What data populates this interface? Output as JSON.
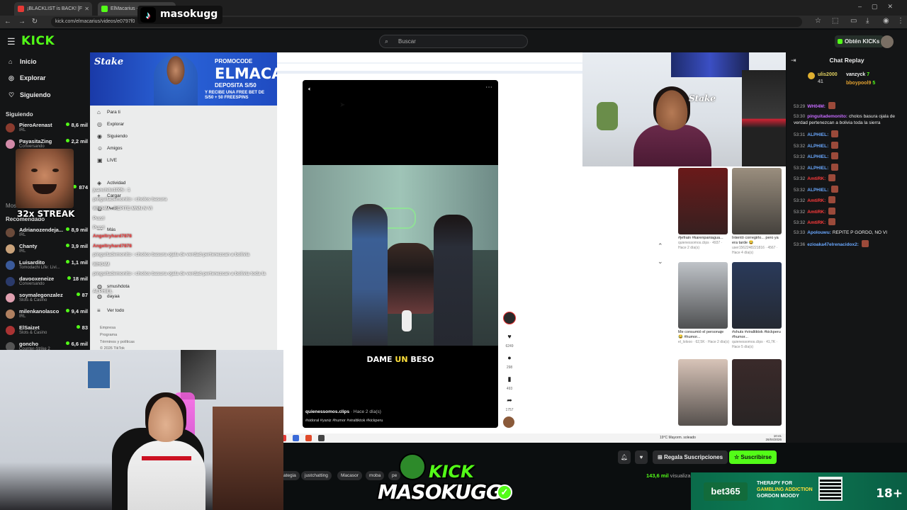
{
  "browser": {
    "tabs": [
      {
        "label": "¡BLACKLIST is BACK! [F",
        "fav_color": "#e53935"
      },
      {
        "label": "ElMacarius - W",
        "fav_color": "#53fc18"
      }
    ],
    "url": "kick.com/elmacarius/videos/e0797f0"
  },
  "overlay": {
    "tiktok_handle": "masokugg",
    "streak_text": "32x STREAK",
    "kick_logo_top": "KICK",
    "kick_logo_bottom": "MASOKUGG"
  },
  "kick": {
    "logo": "KICK",
    "search_placeholder": "Buscar",
    "get_kicks": "Obtén KICKs",
    "nav": [
      {
        "icon": "home-icon",
        "glyph": "⌂",
        "label": "Inicio"
      },
      {
        "icon": "compass-icon",
        "glyph": "◎",
        "label": "Explorar"
      },
      {
        "icon": "heart-icon",
        "glyph": "♡",
        "label": "Siguiendo"
      }
    ],
    "following_heading": "Siguiendo",
    "following": [
      {
        "name": "PieroArenast",
        "category": "IRL",
        "viewers": "8,6 mil",
        "color": "#8a3b2e"
      },
      {
        "name": "PayasitaZing",
        "category": "Conversando",
        "viewers": "2,2 mil",
        "color": "#d28aa8"
      }
    ],
    "partial_viewers": "874",
    "more_label": "Mos",
    "recommended_heading": "Recomendado",
    "recommended": [
      {
        "name": "Adrianozendeja...",
        "category": "IRL",
        "viewers": "8,9 mil",
        "color": "#6a4a3a"
      },
      {
        "name": "Chanty",
        "category": "IRL",
        "viewers": "3,9 mil",
        "color": "#c9a27a"
      },
      {
        "name": "Luisardito",
        "category": "Tomodachi Life: Livi...",
        "viewers": "1,1 mil",
        "color": "#3a5a9a"
      },
      {
        "name": "davooxeneize",
        "category": "Conversando",
        "viewers": "18 mil",
        "color": "#2a3a6a"
      },
      {
        "name": "soymalegonzalez",
        "category": "Slots & Casino",
        "viewers": "87",
        "color": "#e0a0b0"
      },
      {
        "name": "milenkanolasco",
        "category": "IRL",
        "viewers": "9,4 mil",
        "color": "#b08060"
      },
      {
        "name": "ElSaizet",
        "category": "Slots & Casino",
        "viewers": "83",
        "color": "#a33"
      },
      {
        "name": "goncho",
        "category": "Counter-Strike 2",
        "viewers": "6,6 mil",
        "color": "#555"
      }
    ]
  },
  "promo": {
    "brand": "Stake",
    "line1": "PROMOCODE",
    "code": "ELMACA",
    "line2": "DEPOSITA S/50",
    "fine": "Y RECIBE UNA FREE BET DE S/50 + 50 FREESPINS"
  },
  "tiktok": {
    "side": [
      {
        "icon": "home-icon",
        "glyph": "⌂",
        "label": "Para ti"
      },
      {
        "icon": "compass-icon",
        "glyph": "◎",
        "label": "Explorar"
      },
      {
        "icon": "users-icon",
        "glyph": "◉",
        "label": "Siguiendo"
      },
      {
        "icon": "friends-icon",
        "glyph": "☺",
        "label": "Amigos"
      },
      {
        "icon": "live-icon",
        "glyph": "▣",
        "label": "LIVE"
      },
      {
        "icon": "activity-icon",
        "glyph": "◈",
        "label": "Actividad"
      },
      {
        "icon": "upload-icon",
        "glyph": "+",
        "label": "Cargar"
      },
      {
        "icon": "profile-icon",
        "glyph": "◍",
        "label": "Perfil"
      },
      {
        "icon": "more-icon",
        "glyph": "⋯",
        "label": "Más"
      }
    ],
    "following_accounts": [
      "smushdota",
      "dayaa"
    ],
    "see_all": "Ver todo",
    "footer": [
      "Empresa",
      "Programa",
      "Términos y políticas",
      "© 2026 TikTok"
    ],
    "video": {
      "caption_white1": "DAME ",
      "caption_yellow": "UN",
      "caption_white2": " BESO",
      "author": "quienessomos.clips",
      "ago": " · Hace 2 día(s)",
      "tags": "#sidoral #yaniz #humor #viraltiktok #kickperu"
    },
    "actions": [
      {
        "icon": "heart-icon",
        "glyph": "♥",
        "count": "6249"
      },
      {
        "icon": "comment-icon",
        "glyph": "●",
        "count": "298"
      },
      {
        "icon": "bookmark-icon",
        "glyph": "▮",
        "count": "493"
      },
      {
        "icon": "share-icon",
        "glyph": "➦",
        "count": "1757"
      }
    ],
    "thumbs": [
      {
        "caption": "#jefrain #karenpaniagua...",
        "meta": "quienessomos.clips · 4937 · Hace 2 día(s)",
        "color": "#6a1a1a"
      },
      {
        "caption": "Intentó corregirlo... pero ya era tarde 😂",
        "meta": "user1562248221816 · 4567 · Hace 4 día(s)",
        "color": "#9a8e7e"
      },
      {
        "caption": "Me consumió el personaje 😂 #humor...",
        "meta": "el_lolooo · 62,5K · Hace 2 día(s)",
        "color": "#bfc3c8"
      },
      {
        "caption": "#shuts #viraltiktok #kickperu #humor...",
        "meta": "quienessomos.clips · 41,7K · Hace 5 día(s)",
        "color": "#2a3a5a"
      },
      {
        "caption": "",
        "meta": "",
        "color": "#d8c4b8"
      },
      {
        "caption": "",
        "meta": "",
        "color": "#3a2a2a"
      }
    ],
    "taskbar_weather": "19°C Mayorm. soleado",
    "taskbar_time": "10:41",
    "taskbar_date": "26/04/2026"
  },
  "chat": {
    "title": "Chat Replay",
    "gifts": [
      {
        "user": "ulis2000",
        "count": "41"
      },
      {
        "user": "vanzyck",
        "count": "7"
      },
      {
        "user": "bboypool9",
        "count": "5"
      }
    ],
    "messages": [
      {
        "time": "53:29",
        "user": "WH04M:",
        "text": "",
        "color": "#c66bff",
        "emote": true
      },
      {
        "time": "53:30",
        "user": "pinguitademonito:",
        "text": "cholos basura ojala de verdad pertenezcan a bolivia toda la sierra",
        "color": "#c66bff",
        "emote": false
      },
      {
        "time": "53:31",
        "user": "ALPHIEL:",
        "text": "",
        "color": "#6aa8ff",
        "emote": true
      },
      {
        "time": "53:32",
        "user": "ALPHIEL:",
        "text": "",
        "color": "#6aa8ff",
        "emote": true
      },
      {
        "time": "53:32",
        "user": "ALPHIEL:",
        "text": "",
        "color": "#6aa8ff",
        "emote": true
      },
      {
        "time": "53:32",
        "user": "ALPHIEL:",
        "text": "",
        "color": "#6aa8ff",
        "emote": true
      },
      {
        "time": "53:32",
        "user": "AmtiRK:",
        "text": "",
        "color": "#ff3b3b",
        "emote": true
      },
      {
        "time": "53:32",
        "user": "ALPHIEL:",
        "text": "",
        "color": "#6aa8ff",
        "emote": true
      },
      {
        "time": "53:32",
        "user": "AmtiRK:",
        "text": "",
        "color": "#ff3b3b",
        "emote": true
      },
      {
        "time": "53:32",
        "user": "AmtiRK:",
        "text": "",
        "color": "#ff3b3b",
        "emote": true
      },
      {
        "time": "53:32",
        "user": "AmtiRK:",
        "text": "",
        "color": "#ff3b3b",
        "emote": true
      },
      {
        "time": "53:33",
        "user": "Apolouwu:",
        "text": "REPITE P GORDO, NO VI",
        "color": "#6aa8ff",
        "emote": false
      },
      {
        "time": "53:36",
        "user": "ezioaka47elrenacidox2:",
        "text": "",
        "color": "#6aa8ff",
        "emote": true
      }
    ]
  },
  "ghost_chat": [
    {
      "text": "juanchito1005 : 1",
      "cls": ""
    },
    {
      "text": "pinguitademonito : cholos basura",
      "cls": ""
    },
    {
      "text": "WH04M : REPITE MNN N VI",
      "cls": ""
    },
    {
      "text": "Puzzl",
      "cls": ""
    },
    {
      "text": "Puzzl",
      "cls": ""
    },
    {
      "text": "Angeltryhard7878",
      "cls": "r"
    },
    {
      "text": "Angeltryhard7878",
      "cls": "r"
    },
    {
      "text": "pinguitademonito : cholos basura ojala de verdad pertenezcan a bolivia",
      "cls": ""
    },
    {
      "text": "WH04M",
      "cls": ""
    },
    {
      "text": "pinguitademonito : cholos basura ojala de verdad pertenezcan a bolivia toda la",
      "cls": ""
    },
    {
      "text": "ALPHIEL",
      "cls": ""
    }
  ],
  "bottom": {
    "subs_gift": "Regala Suscripciones",
    "subscribe": "Suscribirse",
    "viewers": "143,6 mil",
    "viewers_suffix": " visualiza",
    "tags": [
      "ategia",
      "justchatting",
      "Macasor",
      "moba",
      "pe"
    ]
  },
  "ad": {
    "brand": "bet365",
    "line1": "THERAPY FOR",
    "line2": "GAMBLING ADDICTION",
    "line3": "GORDON MOODY",
    "age": "18+"
  }
}
